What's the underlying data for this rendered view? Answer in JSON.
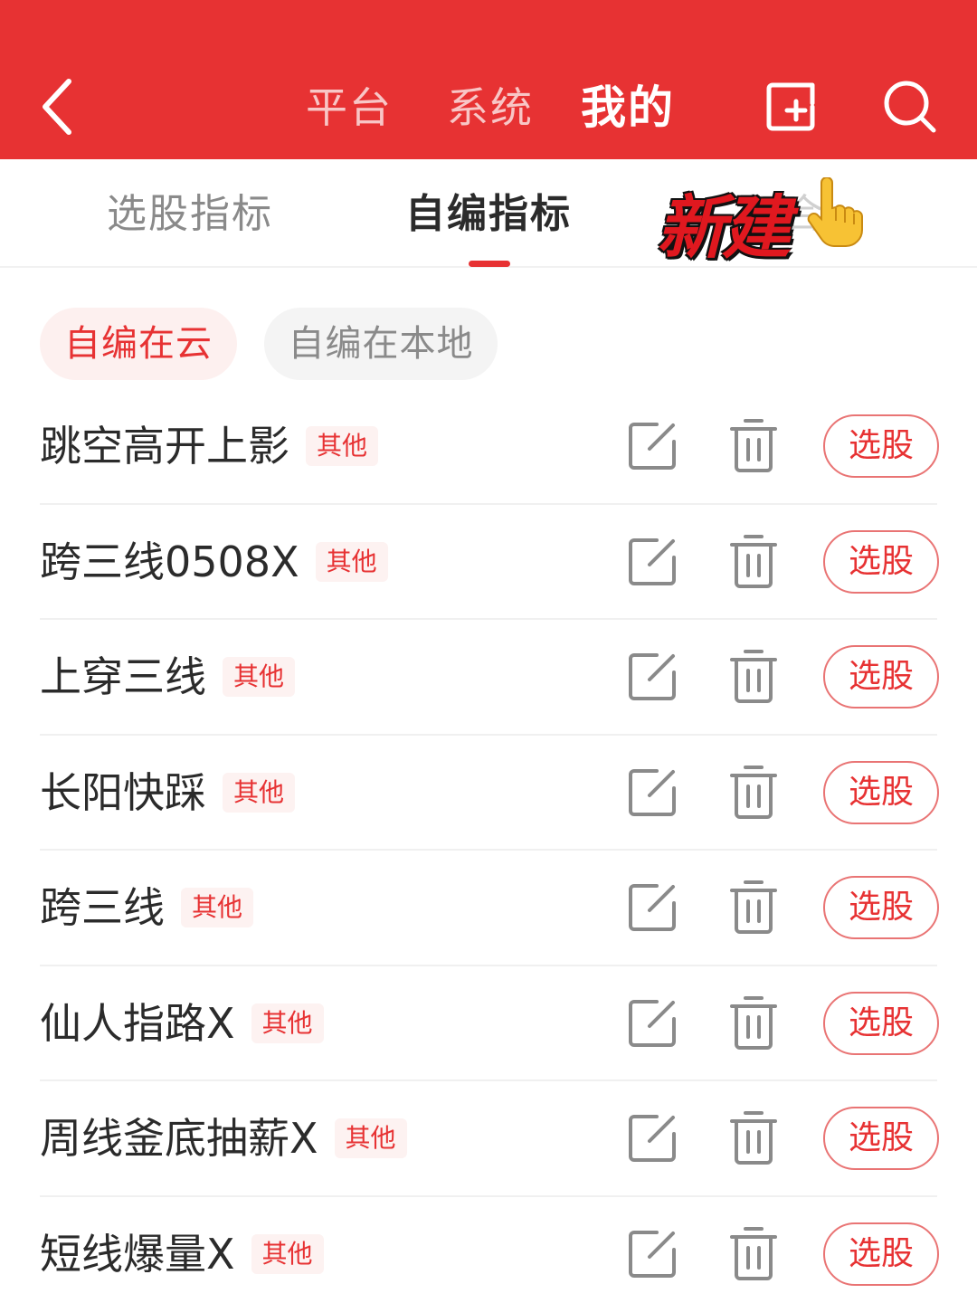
{
  "header": {
    "back_icon": "chevron-left-icon",
    "tabs": [
      {
        "label": "平台",
        "active": false
      },
      {
        "label": "系统",
        "active": false
      },
      {
        "label": "我的",
        "active": true
      }
    ],
    "new_icon": "add-window-icon",
    "search_icon": "search-icon",
    "background_color": "#e73233"
  },
  "subtabs": {
    "items": [
      {
        "label": "选股指标",
        "active": false
      },
      {
        "label": "自编指标",
        "active": true
      },
      {
        "label": "组合",
        "active": false
      }
    ],
    "overlay_text": "新建",
    "overlay_icon": "pointing-hand-icon"
  },
  "chips": {
    "cloud": "自编在云",
    "local": "自编在本地"
  },
  "list": {
    "rows": [
      {
        "name": "跳空高开上影",
        "tag": "其他",
        "action": "选股"
      },
      {
        "name": "跨三线0508X",
        "tag": "其他",
        "action": "选股"
      },
      {
        "name": "上穿三线",
        "tag": "其他",
        "action": "选股"
      },
      {
        "name": "长阳快踩",
        "tag": "其他",
        "action": "选股"
      },
      {
        "name": "跨三线",
        "tag": "其他",
        "action": "选股"
      },
      {
        "name": "仙人指路X",
        "tag": "其他",
        "action": "选股"
      },
      {
        "name": "周线釜底抽薪X",
        "tag": "其他",
        "action": "选股"
      },
      {
        "name": "短线爆量X",
        "tag": "其他",
        "action": "选股"
      }
    ],
    "edit_icon": "edit-icon",
    "delete_icon": "trash-icon"
  }
}
